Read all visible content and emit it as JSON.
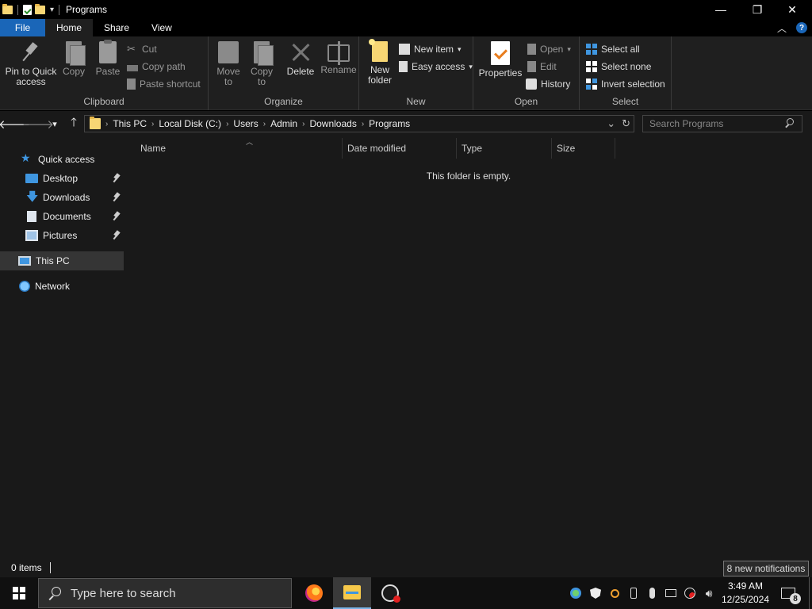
{
  "window": {
    "title": "Programs",
    "minimize_glyph": "—",
    "maximize_glyph": "❐",
    "close_glyph": "✕",
    "dropdown_glyph": "▾"
  },
  "tabs": [
    {
      "label": "File"
    },
    {
      "label": "Home"
    },
    {
      "label": "Share"
    },
    {
      "label": "View"
    }
  ],
  "ribbon_controls": {
    "collapse_glyph": "︿",
    "help_glyph": "?"
  },
  "ribbon": {
    "clipboard": {
      "label": "Clipboard",
      "pin": "Pin to Quick access",
      "copy": "Copy",
      "paste": "Paste",
      "cut": "Cut",
      "copy_path": "Copy path",
      "paste_shortcut": "Paste shortcut"
    },
    "organize": {
      "label": "Organize",
      "move_to": "Move to",
      "copy_to": "Copy to",
      "delete": "Delete",
      "rename": "Rename"
    },
    "new": {
      "label": "New",
      "new_folder": "New folder",
      "new_item": "New item",
      "easy_access": "Easy access"
    },
    "open": {
      "label": "Open",
      "properties": "Properties",
      "open": "Open",
      "edit": "Edit",
      "history": "History"
    },
    "select": {
      "label": "Select",
      "select_all": "Select all",
      "select_none": "Select none",
      "invert": "Invert selection"
    }
  },
  "nav_buttons": {
    "back": "🡐",
    "forward": "🡒",
    "recent": "▾",
    "up": "🡑"
  },
  "address": {
    "breadcrumbs": [
      "This PC",
      "Local Disk (C:)",
      "Users",
      "Admin",
      "Downloads",
      "Programs"
    ],
    "separator": "›",
    "dropdown": "⌄",
    "refresh": "↻"
  },
  "search": {
    "placeholder": "Search Programs"
  },
  "nav_pane": {
    "quick_access": "Quick access",
    "items": [
      "Desktop",
      "Downloads",
      "Documents",
      "Pictures"
    ],
    "this_pc": "This PC",
    "network": "Network"
  },
  "columns": [
    "Name",
    "Date modified",
    "Type",
    "Size"
  ],
  "sort_indicator": "︿",
  "empty_message": "This folder is empty.",
  "status": {
    "items": "0 items"
  },
  "notifications_tooltip": "8 new notifications",
  "taskbar": {
    "search_placeholder": "Type here to search",
    "time": "3:49 AM",
    "date": "12/25/2024",
    "notification_count": "8"
  },
  "colors": {
    "accent": "#1a66b8",
    "folder": "#f7d674",
    "background": "#191919",
    "ribbon": "#1f1f1f"
  }
}
